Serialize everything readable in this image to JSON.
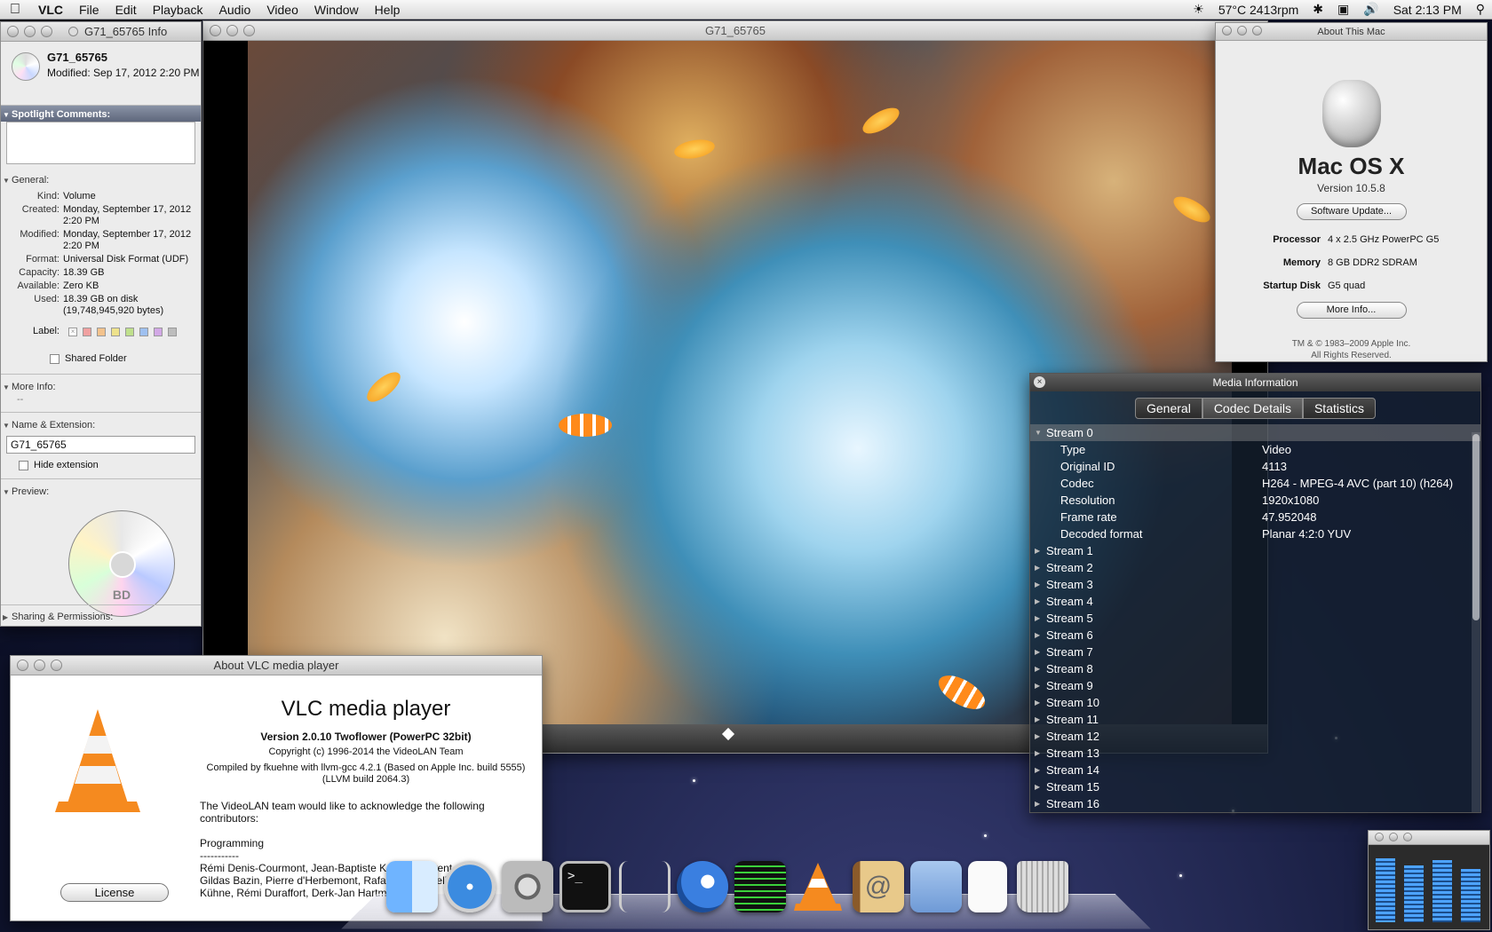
{
  "menubar": {
    "app": "VLC",
    "items": [
      "File",
      "Edit",
      "Playback",
      "Audio",
      "Video",
      "Window",
      "Help"
    ],
    "status": {
      "temp": "57°C 2413rpm",
      "clock": "Sat 2:13 PM"
    }
  },
  "info_window": {
    "title": "G71_65765 Info",
    "name": "G71_65765",
    "modified_header": "Modified: Sep 17, 2012 2:20 PM",
    "spotlight_label": "Spotlight Comments:",
    "general_label": "General:",
    "general": [
      {
        "k": "Kind:",
        "v": "Volume"
      },
      {
        "k": "Created:",
        "v": "Monday, September 17, 2012"
      },
      {
        "k": "",
        "v": "2:20 PM"
      },
      {
        "k": "Modified:",
        "v": "Monday, September 17, 2012"
      },
      {
        "k": "",
        "v": "2:20 PM"
      },
      {
        "k": "Format:",
        "v": "Universal Disk Format (UDF)"
      },
      {
        "k": "Capacity:",
        "v": "18.39 GB"
      },
      {
        "k": "Available:",
        "v": "Zero KB"
      },
      {
        "k": "Used:",
        "v": "18.39 GB on disk"
      },
      {
        "k": "",
        "v": "(19,748,945,920 bytes)"
      }
    ],
    "label_label": "Label:",
    "shared_folder": "Shared Folder",
    "more_info_label": "More Info:",
    "more_info_value": "--",
    "name_ext_label": "Name & Extension:",
    "name_value": "G71_65765",
    "hide_extension": "Hide extension",
    "preview_label": "Preview:",
    "disc_text": "BD",
    "sharing_label": "Sharing & Permissions:"
  },
  "vlc_window": {
    "title": "G71_65765"
  },
  "about_mac": {
    "title": "About This Mac",
    "os_name": "Mac OS X",
    "version": "Version 10.5.8",
    "software_update": "Software Update...",
    "processor_k": "Processor",
    "processor_v": "4 x 2.5 GHz PowerPC G5",
    "memory_k": "Memory",
    "memory_v": "8 GB DDR2 SDRAM",
    "startup_k": "Startup Disk",
    "startup_v": "G5 quad",
    "more_info": "More Info...",
    "copyright1": "TM & © 1983–2009 Apple Inc.",
    "copyright2": "All Rights Reserved."
  },
  "media_info": {
    "title": "Media Information",
    "tabs": [
      "General",
      "Codec Details",
      "Statistics"
    ],
    "stream0": "Stream 0",
    "props": [
      {
        "k": "Type",
        "v": "Video"
      },
      {
        "k": "Original ID",
        "v": "4113"
      },
      {
        "k": "Codec",
        "v": "H264 - MPEG-4 AVC (part 10) (h264)"
      },
      {
        "k": "Resolution",
        "v": "1920x1080"
      },
      {
        "k": "Frame rate",
        "v": "47.952048"
      },
      {
        "k": "Decoded format",
        "v": "Planar 4:2:0 YUV"
      }
    ],
    "streams": [
      "Stream 1",
      "Stream 2",
      "Stream 3",
      "Stream 4",
      "Stream 5",
      "Stream 6",
      "Stream 7",
      "Stream 8",
      "Stream 9",
      "Stream 10",
      "Stream 11",
      "Stream 12",
      "Stream 13",
      "Stream 14",
      "Stream 15",
      "Stream 16"
    ]
  },
  "about_vlc": {
    "title": "About VLC media player",
    "name": "VLC media player",
    "version": "Version 2.0.10 Twoflower (PowerPC 32bit)",
    "copyright": "Copyright (c) 1996-2014 the VideoLAN Team",
    "compiled1": "Compiled by fkuehne with llvm-gcc 4.2.1 (Based on Apple Inc. build 5555)",
    "compiled2": "(LLVM build 2064.3)",
    "thanks": "The VideoLAN team would like to acknowledge the following contributors:",
    "programming": "Programming",
    "dashes": "-----------",
    "credits1": "Rémi Denis-Courmont, Jean-Baptiste Kempf, Laurent Aimar,",
    "credits2": "Gildas Bazin, Pierre d'Herbemont, Rafaël Carré, Felix Paul",
    "credits3": "Kühne, Rémi Duraffort, Derk-Jan Hartman,",
    "license": "License"
  },
  "colors": {
    "hud_bg": "#142030",
    "vlc_orange": "#f58a1f",
    "aqua_blue": "#4da3ff"
  }
}
